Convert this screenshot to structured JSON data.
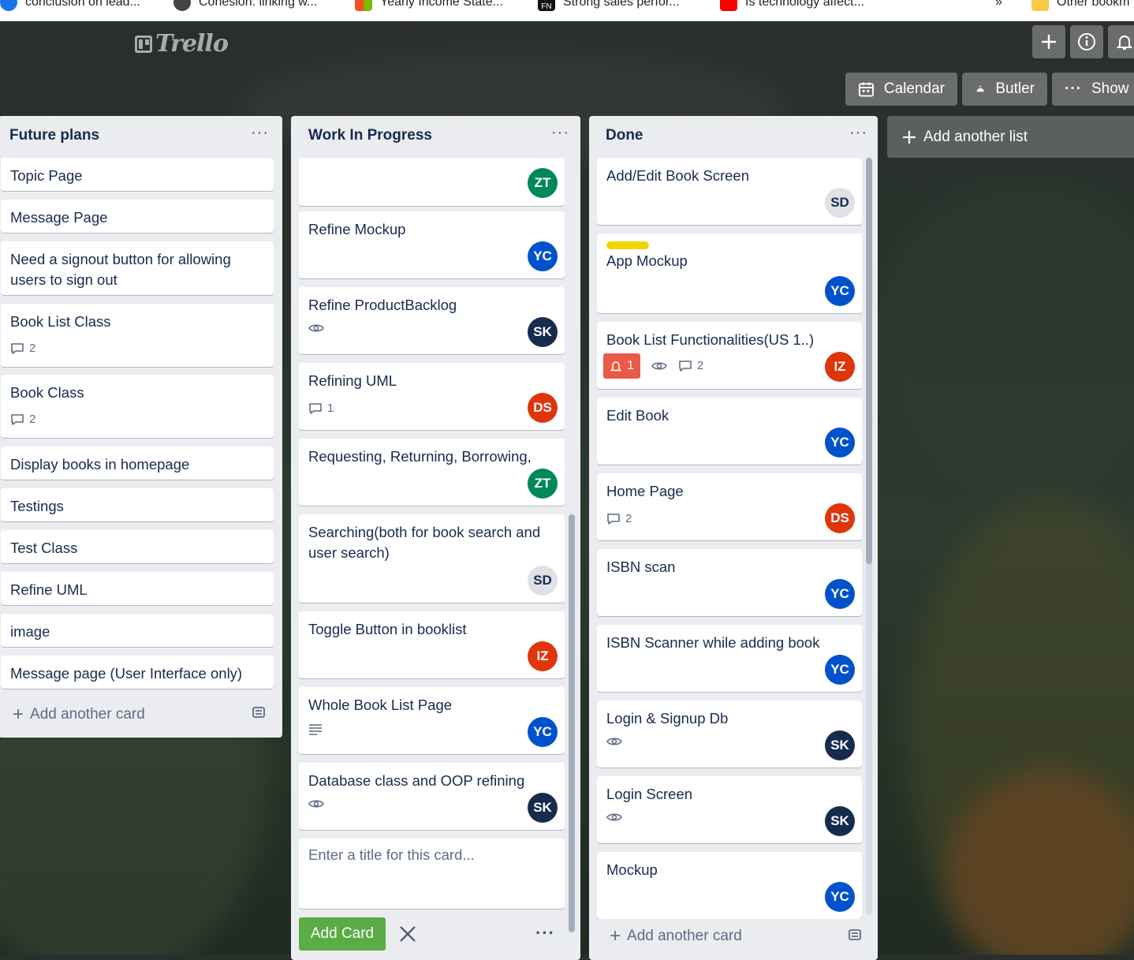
{
  "bookmarks": [
    {
      "label": "conclusion on lead...",
      "color": "#1a73e8"
    },
    {
      "label": "Cohesion: linking w...",
      "color": "#444444"
    },
    {
      "label": "Yearly Income State...",
      "color": "#f25022"
    },
    {
      "label": "Strong sales perfor...",
      "color": "#111111",
      "badge": "FN"
    },
    {
      "label": "Is technology affect...",
      "color": "#ff0000"
    },
    {
      "label": "»",
      "color": "#ffffff"
    },
    {
      "label": "Other bookm",
      "color": "#f7c948"
    }
  ],
  "header": {
    "logo": "Trello",
    "icons": [
      "plus-icon",
      "info-icon",
      "bell-icon"
    ]
  },
  "board_buttons": [
    {
      "label": "Calendar",
      "icon": "calendar-icon"
    },
    {
      "label": "Butler",
      "icon": "butler-icon"
    },
    {
      "label": "Show M",
      "icon": "ellipsis-icon"
    }
  ],
  "colors": {
    "list_bg": "#ebecf0",
    "label_yellow": "#f2d600",
    "notification_red": "#eb5a46",
    "add_button_green": "#5aac44"
  },
  "avatars": {
    "ZT": "#00875a",
    "YC": "#0052cc",
    "SK": "#172b4d",
    "DS": "#de350b",
    "SD": "#dfe1e6",
    "IZ": "#de350b"
  },
  "lists": [
    {
      "title": "Future plans",
      "menu": "···",
      "cards": [
        {
          "title": "Topic Page"
        },
        {
          "title": "Message Page"
        },
        {
          "title": "Need a signout button for allowing users to sign out"
        },
        {
          "title": "Book List Class",
          "comments": "2"
        },
        {
          "title": "Book Class",
          "comments": "2"
        },
        {
          "title": "Display books in homepage"
        },
        {
          "title": "Testings"
        },
        {
          "title": "Test Class"
        },
        {
          "title": "Refine UML"
        },
        {
          "title": "image"
        },
        {
          "title": "Message page (User Interface only)"
        }
      ],
      "add_card": "Add another card"
    },
    {
      "title": "Work In Progress",
      "menu": "···",
      "cards": [
        {
          "title": "",
          "member": "ZT"
        },
        {
          "title": "Refine Mockup",
          "member": "YC"
        },
        {
          "title": "Refine ProductBacklog",
          "watch": true,
          "member": "SK"
        },
        {
          "title": "Refining UML",
          "comments": "1",
          "member": "DS"
        },
        {
          "title": "Requesting, Returning, Borrowing,",
          "member": "ZT"
        },
        {
          "title": "Searching(both for book search and user search)",
          "member": "SD"
        },
        {
          "title": "Toggle Button in booklist",
          "member": "IZ"
        },
        {
          "title": "Whole Book List Page",
          "description": true,
          "member": "YC"
        },
        {
          "title": "Database class and OOP refining",
          "watch": true,
          "member": "SK"
        }
      ],
      "composer_placeholder": "Enter a title for this card...",
      "add_button": "Add Card"
    },
    {
      "title": "Done",
      "menu": "···",
      "cards": [
        {
          "title": "Add/Edit Book Screen",
          "member": "SD"
        },
        {
          "title": "App Mockup",
          "label": "yellow",
          "member": "YC"
        },
        {
          "title": "Book List Functionalities(US 1..)",
          "notifications": "1",
          "watch": true,
          "comments": "2",
          "member": "IZ"
        },
        {
          "title": "Edit Book",
          "member": "YC"
        },
        {
          "title": "Home Page",
          "comments": "2",
          "member": "DS"
        },
        {
          "title": "ISBN scan",
          "member": "YC"
        },
        {
          "title": "ISBN Scanner while adding book",
          "member": "YC"
        },
        {
          "title": "Login & Signup Db",
          "watch": true,
          "member": "SK"
        },
        {
          "title": "Login Screen",
          "watch": true,
          "member": "SK"
        },
        {
          "title": "Mockup",
          "member": "YC"
        }
      ],
      "add_card": "Add another card"
    }
  ],
  "add_list": "Add another list"
}
